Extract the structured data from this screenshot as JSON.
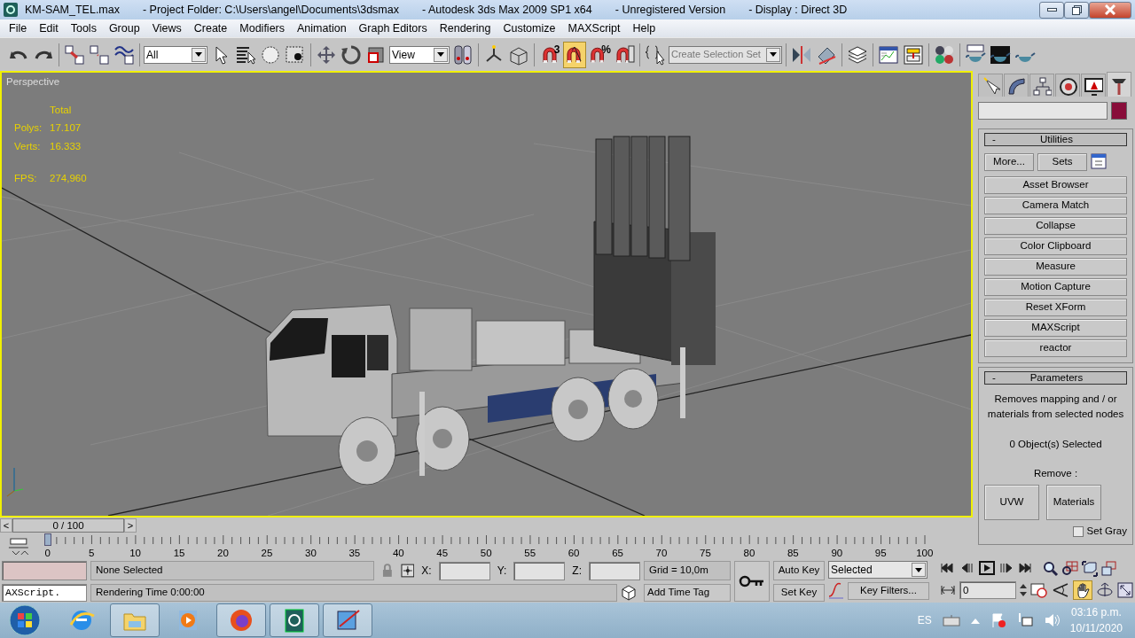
{
  "window": {
    "title_parts": [
      "KM-SAM_TEL.max",
      "- Project Folder: C:\\Users\\angel\\Documents\\3dsmax",
      "- Autodesk 3ds Max  2009 SP1  x64",
      "- Unregistered Version",
      "- Display : Direct 3D"
    ]
  },
  "menu": [
    "File",
    "Edit",
    "Tools",
    "Group",
    "Views",
    "Create",
    "Modifiers",
    "Animation",
    "Graph Editors",
    "Rendering",
    "Customize",
    "MAXScript",
    "Help"
  ],
  "toolbar": {
    "selection_filter": "All",
    "reference_coord": "View",
    "selection_set": {
      "placeholder": "Create Selection Set"
    },
    "snaps": [
      {
        "kind": "snap3d",
        "label": "3",
        "on": false
      },
      {
        "kind": "angle",
        "on": true
      },
      {
        "kind": "percent",
        "label": "%",
        "on": false
      },
      {
        "kind": "spinner",
        "on": false
      }
    ]
  },
  "viewport": {
    "label": "Perspective",
    "active": true,
    "stats_header": "Total",
    "stats": [
      {
        "label": "Polys:",
        "value": "17.107"
      },
      {
        "label": "Verts:",
        "value": "16.333"
      },
      {
        "label": "FPS:",
        "value": "274,960"
      }
    ]
  },
  "command_panel": {
    "tabs": [
      {
        "selected": false
      },
      {
        "selected": false
      },
      {
        "selected": false
      },
      {
        "selected": false
      },
      {
        "selected": false
      },
      {
        "selected": true
      }
    ],
    "utilities": {
      "toggle": "-",
      "title": "Utilities",
      "top_buttons": [
        "More...",
        "Sets"
      ],
      "buttons": [
        "Asset Browser",
        "Camera Match",
        "Collapse",
        "Color Clipboard",
        "Measure",
        "Motion Capture",
        "Reset XForm",
        "MAXScript",
        "reactor"
      ]
    },
    "parameters": {
      "toggle": "-",
      "title": "Parameters",
      "description": "Removes mapping and / or materials from selected nodes",
      "count": "0 Object(s) Selected",
      "remove_label": "Remove :",
      "buttons": [
        "UVW",
        "Materials"
      ],
      "checkbox": {
        "label": "Set Gray",
        "checked": false
      }
    }
  },
  "time_slider": {
    "prev": "<",
    "frame": "0 / 100",
    "next": ">",
    "level": 0
  },
  "track_bar": {
    "ticks": [
      "0",
      "5",
      "10",
      "15",
      "20",
      "25",
      "30",
      "35",
      "40",
      "45",
      "50",
      "55",
      "60",
      "65",
      "70",
      "75",
      "80",
      "85",
      "90",
      "95",
      "100"
    ]
  },
  "status": {
    "listener": "AXScript.",
    "prompt": "None Selected",
    "info": "Rendering Time  0:00:00",
    "x_label": "X:",
    "y_label": "Y:",
    "z_label": "Z:",
    "grid": "Grid = 10,0m",
    "add_time_tag": "Add Time Tag",
    "auto_key": "Auto Key",
    "set_key": "Set Key",
    "key_mode": "Selected",
    "key_filters": "Key Filters...",
    "frame": "0",
    "pan_active": true
  },
  "taskbar": {
    "apps": [
      {
        "selected": false
      },
      {
        "selected": true
      },
      {
        "selected": false
      },
      {
        "selected": true
      },
      {
        "selected": true
      },
      {
        "selected": true
      }
    ],
    "language": "ES",
    "time": "03:16 p.m.",
    "date": "10/11/2020"
  }
}
